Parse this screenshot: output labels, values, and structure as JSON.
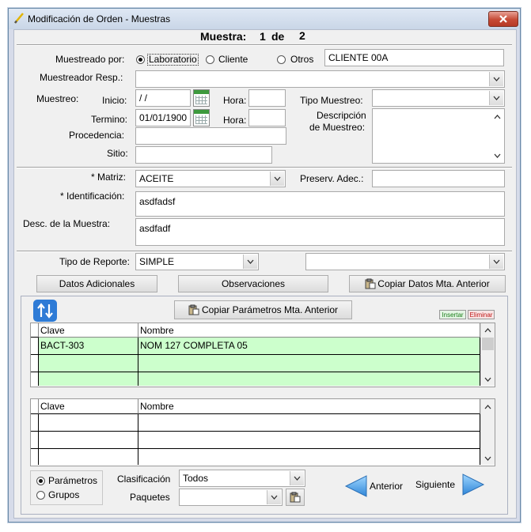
{
  "window": {
    "title": "Modificación de Orden - Muestras"
  },
  "header": {
    "muestra_label": "Muestra:",
    "current": "1",
    "de_label": "de",
    "total": "2"
  },
  "muestreado": {
    "label": "Muestreado por:",
    "options": [
      "Laboratorio",
      "Cliente",
      "Otros"
    ],
    "selected": "Laboratorio",
    "cliente_value": "CLIENTE 00A"
  },
  "muestreador": {
    "label": "Muestreador Resp.:",
    "value": ""
  },
  "muestreo": {
    "label": "Muestreo:",
    "inicio_label": "Inicio:",
    "inicio_value": " / /",
    "termino_label": "Termino:",
    "termino_value": "01/01/1900",
    "hora_label": "Hora:",
    "hora_inicio": "",
    "hora_termino": "",
    "tipo_label": "Tipo Muestreo:",
    "tipo_value": "",
    "descripcion_label_1": "Descripción",
    "descripcion_label_2": "de Muestreo:",
    "descripcion_value": "",
    "procedencia_label": "Procedencia:",
    "procedencia_value": "",
    "sitio_label": "Sitio:",
    "sitio_value": ""
  },
  "matriz": {
    "label": "* Matriz:",
    "value": "ACEITE",
    "preserv_label": "Preserv. Adec.:",
    "preserv_value": "",
    "ident_label": "* Identificación:",
    "ident_value": "asdfadsf",
    "desc_label": "Desc. de la Muestra:",
    "desc_value": "asdfadf"
  },
  "reporte": {
    "label": "Tipo de Reporte:",
    "value": "SIMPLE",
    "second_value": ""
  },
  "buttons": {
    "datos_adicionales": "Datos Adicionales",
    "observaciones": "Observaciones",
    "copiar_datos": "Copiar Datos Mta. Anterior",
    "copiar_parametros": "Copiar Parámetros Mta. Anterior",
    "insertar": "Insertar",
    "eliminar": "Eliminar",
    "anterior": "Anterior",
    "siguiente": "Siguiente"
  },
  "grid_top": {
    "columns": [
      "Clave",
      "Nombre"
    ],
    "rows": [
      {
        "clave": "BACT-303",
        "nombre": "NOM  127  COMPLETA  05"
      },
      {
        "clave": "",
        "nombre": ""
      },
      {
        "clave": "",
        "nombre": ""
      }
    ]
  },
  "grid_bottom": {
    "columns": [
      "Clave",
      "Nombre"
    ],
    "rows": [
      {
        "clave": "",
        "nombre": ""
      },
      {
        "clave": "",
        "nombre": ""
      },
      {
        "clave": "",
        "nombre": ""
      }
    ]
  },
  "mode": {
    "options": [
      "Parámetros",
      "Grupos"
    ],
    "selected": "Parámetros"
  },
  "clasificacion": {
    "label": "Clasificación",
    "value": "Todos"
  },
  "paquetes": {
    "label": "Paquetes",
    "value": ""
  },
  "colors": {
    "grid_row_bg": "#ccffcc",
    "accent_arrow": "#2e7bd6",
    "insertar": "#1a7f1a",
    "eliminar": "#c01818"
  },
  "icons": [
    "pencil-icon",
    "close-icon",
    "calendar-icon",
    "clipboard-icon",
    "swap-arrows-icon",
    "left-arrow-icon",
    "right-arrow-icon",
    "chevron-down-icon",
    "chevron-up-icon"
  ]
}
